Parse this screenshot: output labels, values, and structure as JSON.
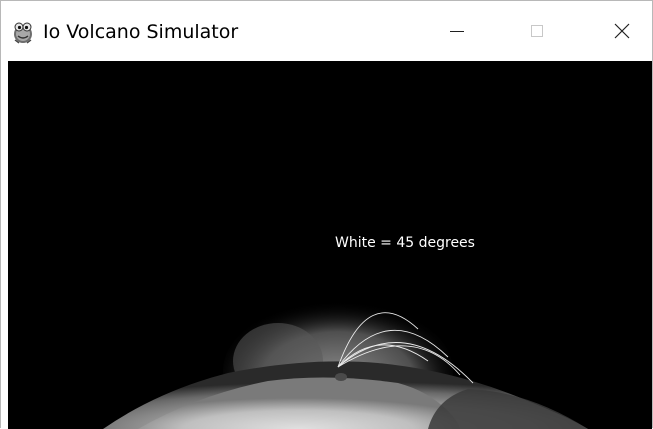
{
  "window": {
    "title": "Io Volcano Simulator",
    "icon": "pygame-snake-icon",
    "controls": {
      "minimize_icon": "minimize-icon",
      "maximize_icon": "maximize-icon",
      "close_icon": "close-icon"
    }
  },
  "scene": {
    "background_color": "#000000",
    "legend_text": "White = 45 degrees",
    "trajectory_color": "#ffffff"
  }
}
